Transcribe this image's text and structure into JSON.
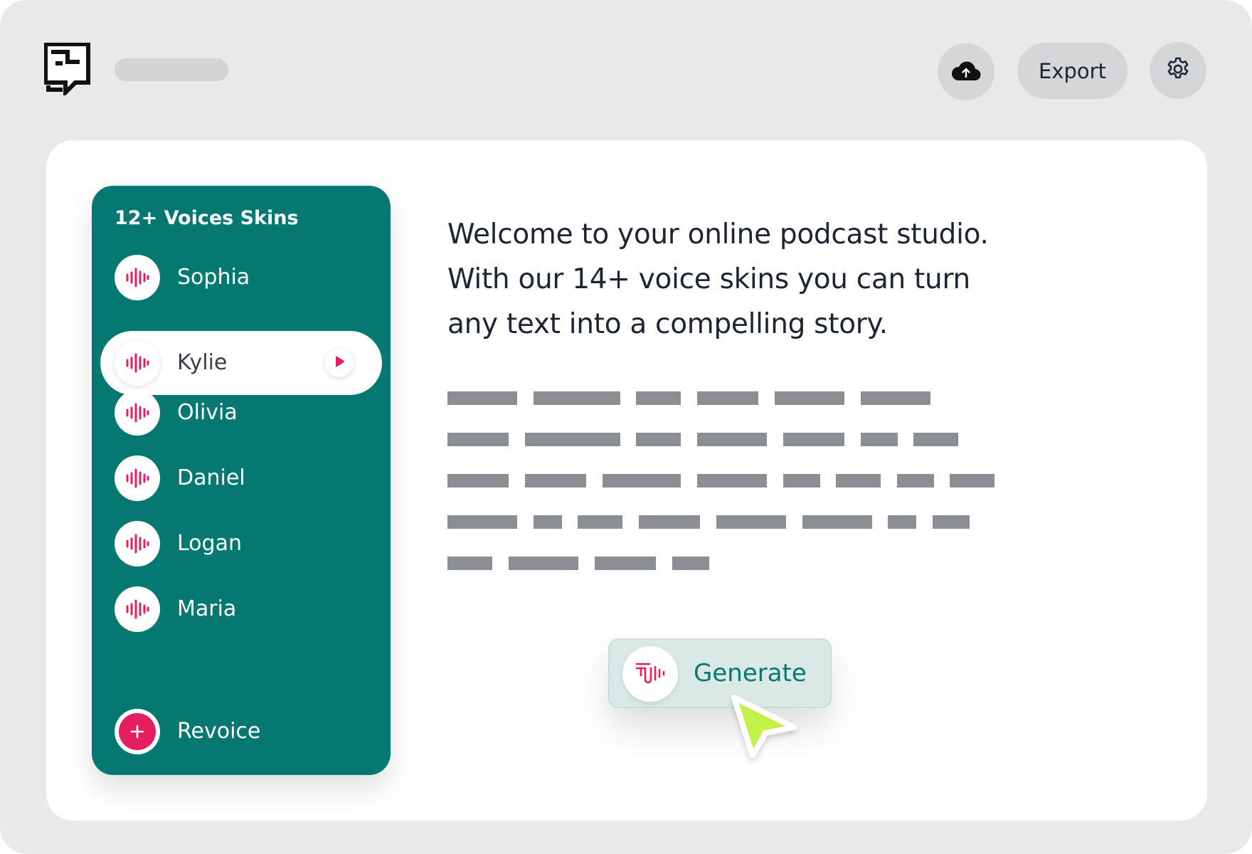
{
  "header": {
    "logo_icon": "chat-bubble-logo-icon",
    "upload_icon": "cloud-upload-icon",
    "export_label": "Export",
    "settings_icon": "gear-icon"
  },
  "voice_panel": {
    "title": "12+ Voices Skins",
    "voices": [
      {
        "name": "Sophia",
        "selected": false
      },
      {
        "name": "Kylie",
        "selected": true
      },
      {
        "name": "Olivia",
        "selected": false
      },
      {
        "name": "Daniel",
        "selected": false
      },
      {
        "name": "Logan",
        "selected": false
      },
      {
        "name": "Maria",
        "selected": false
      }
    ],
    "voice_icon": "waveform-icon",
    "play_icon": "play-icon",
    "revoice_label": "Revoice",
    "revoice_icon": "plus-icon"
  },
  "content": {
    "welcome_lines": [
      "Welcome to your online podcast studio.",
      "With our 14+ voice skins you can turn",
      "any text into a compelling story."
    ]
  },
  "generate": {
    "label": "Generate",
    "icon": "generate-waveform-icon"
  },
  "colors": {
    "background": "#e9e9e9",
    "card": "#ffffff",
    "panel": "#057872",
    "accent_pink": "#e41e5f",
    "text_dark": "#1d2433",
    "placeholder_gray": "#8b8f93",
    "cursor_green": "#c3f04a"
  }
}
